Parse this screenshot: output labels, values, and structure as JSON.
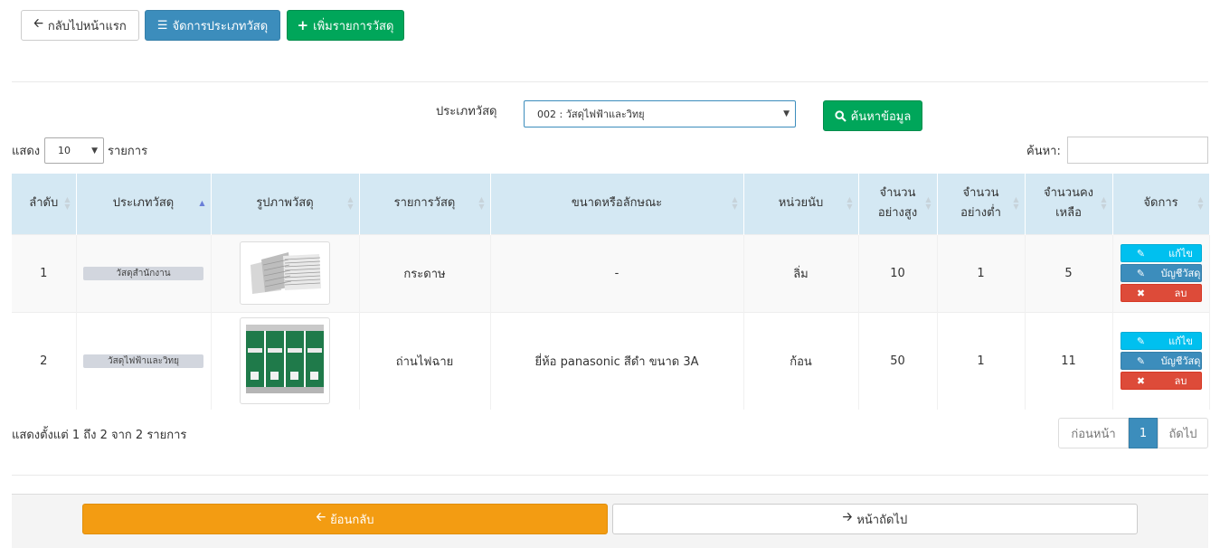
{
  "toolbar": {
    "back_home": "กลับไปหน้าแรก",
    "manage_types": "จัดการประเภทวัสดุ",
    "add_item": "เพิ่มรายการวัสดุ"
  },
  "filter": {
    "type_label": "ประเภทวัสดุ",
    "type_selected": "002 : วัสดุไฟฟ้าและวิทยุ",
    "search_button": "ค้นหาข้อมูล"
  },
  "list_controls": {
    "show_prefix": "แสดง",
    "page_size": "10",
    "show_suffix": "รายการ",
    "search_label": "ค้นหา:"
  },
  "table": {
    "headers": [
      "ลำดับ",
      "ประเภทวัสดุ",
      "รูปภาพวัสดุ",
      "รายการวัสดุ",
      "ขนาดหรือลักษณะ",
      "หน่วยนับ",
      "จำนวน\nอย่างสูง",
      "จำนวน\nอย่างต่ำ",
      "จำนวนคง\nเหลือ",
      "จัดการ"
    ],
    "rows": [
      {
        "no": "1",
        "type": "วัสดุสำนักงาน",
        "image": "paper-stack-image",
        "name": "กระดาษ",
        "size": "-",
        "unit": "ลิ่ม",
        "max": "10",
        "min": "1",
        "remain": "5"
      },
      {
        "no": "2",
        "type": "วัสดุไฟฟ้าและวิทยุ",
        "image": "batteries-image",
        "name": "ถ่านไฟฉาย",
        "size": "ยี่ห้อ panasonic สีดำ ขนาด 3A",
        "unit": "ก้อน",
        "max": "50",
        "min": "1",
        "remain": "11"
      }
    ],
    "actions": {
      "edit": "แก้ไข",
      "account": "บัญชีวัสดุ",
      "delete": "ลบ"
    }
  },
  "info": "แสดงตั้งแต่ 1 ถึง 2 จาก 2 รายการ",
  "pagination": {
    "prev": "ก่อนหน้า",
    "current": "1",
    "next": "ถัดไป"
  },
  "footer": {
    "back": "ย้อนกลับ",
    "next": "หน้าถัดไป"
  },
  "colors": {
    "primary": "#3c8dbc",
    "success": "#00a65a",
    "warning": "#f39c12",
    "danger": "#dd4b39",
    "info": "#00c0ef",
    "header_bg": "#d4e8f3"
  }
}
